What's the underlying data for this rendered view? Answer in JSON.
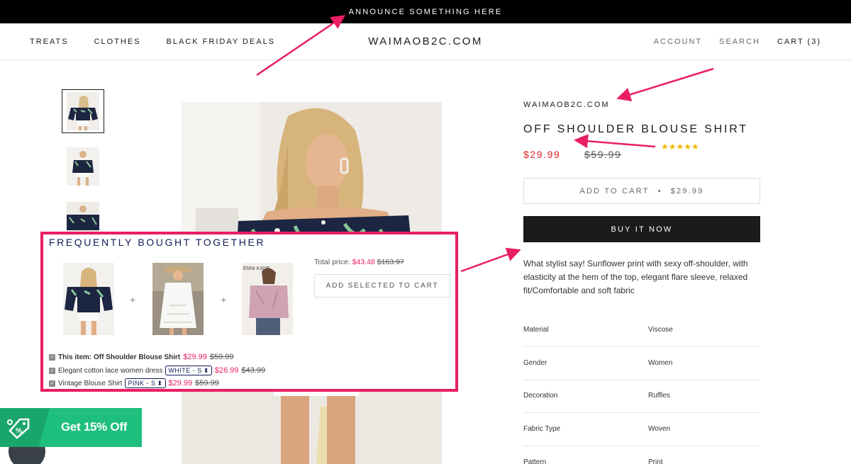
{
  "announcement": "ANNOUNCE SOMETHING HERE",
  "header": {
    "nav_left": [
      "TREATS",
      "CLOTHES",
      "BLACK FRIDAY DEALS"
    ],
    "logo": "WAIMAOB2C.COM",
    "account": "ACCOUNT",
    "search": "SEARCH",
    "cart": "CART (3)"
  },
  "product": {
    "vendor": "WAIMAOB2C.COM",
    "title": "OFF SHOULDER BLOUSE SHIRT",
    "price": "$29.99",
    "compare_price": "$59.99",
    "rating_stars": "★★★★★",
    "add_to_cart": "ADD TO CART",
    "add_to_cart_sep": "•",
    "add_to_cart_price": "$29.99",
    "buy_now": "BUY IT NOW",
    "description": "What stylist say!  Sunflower print with sexy off-shoulder, with elasticity at the hem of the top, elegant flare sleeve, relaxed fit/Comfortable and soft fabric",
    "specs": [
      {
        "key": "Material",
        "value": "Viscose"
      },
      {
        "key": "Gender",
        "value": "Women"
      },
      {
        "key": "Decoration",
        "value": "Ruffles"
      },
      {
        "key": "Fabric Type",
        "value": "Woven"
      },
      {
        "key": "Pattern",
        "value": "Print"
      }
    ]
  },
  "fbt": {
    "title": "FREQUENTLY BOUGHT TOGETHER",
    "total_label": "Total price:",
    "total_price": "$43.48",
    "total_compare": "$163.97",
    "button": "ADD SELECTED TO CART",
    "plus": "+",
    "items": [
      {
        "label": "This item: Off Shoulder Blouse Shirt",
        "option": "",
        "price": "$29.99",
        "compare": "$59.99"
      },
      {
        "label": "Elegant cotton lace women dress",
        "option": "WHITE - S",
        "price": "$26.99",
        "compare": "$43.99"
      },
      {
        "label": "Vintage Blouse Shirt",
        "option": "PINK - S",
        "price": "$29.99",
        "compare": "$59.99"
      }
    ]
  },
  "promo": {
    "text": "Get 15% Off"
  },
  "colors": {
    "accent_pink": "#e91e63",
    "price_red": "#e22120",
    "promo_green": "#1fbf7d",
    "star_gold": "#f5b800",
    "fbt_navy": "#111a57"
  },
  "icons": [
    "tag-percent-icon",
    "select-arrows-icon",
    "checkbox-icon",
    "annotation-arrow"
  ]
}
